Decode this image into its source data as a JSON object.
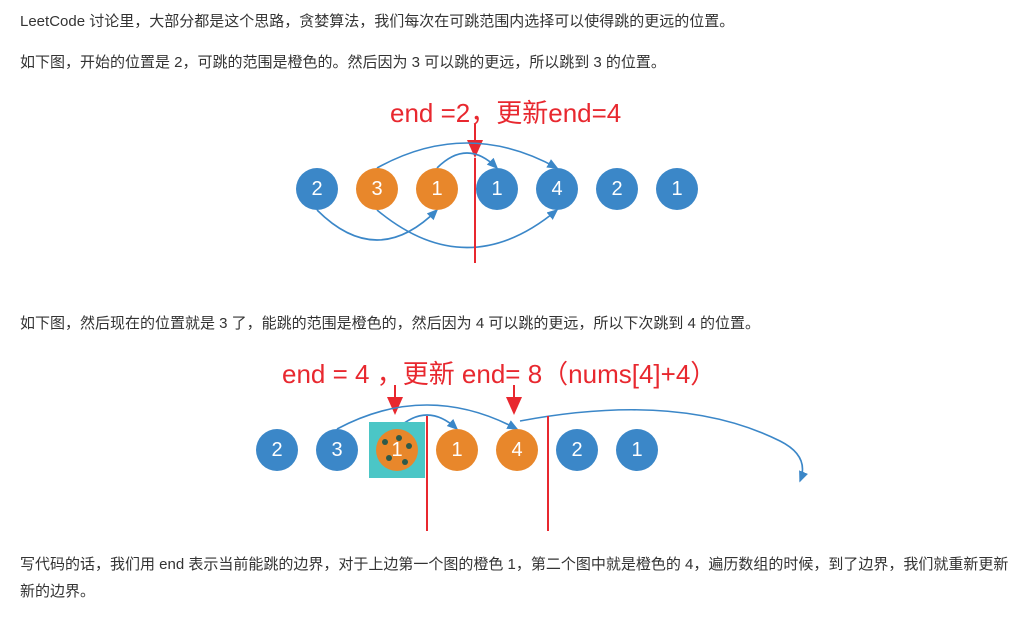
{
  "para1": "LeetCode 讨论里，大部分都是这个思路，贪婪算法，我们每次在可跳范围内选择可以使得跳的更远的位置。",
  "para2": "如下图，开始的位置是 2，可跳的范围是橙色的。然后因为 3 可以跳的更远，所以跳到 3 的位置。",
  "diagram1": {
    "annotation": "end =2，更新end=4",
    "circles": [
      {
        "val": "2",
        "color": "blue"
      },
      {
        "val": "3",
        "color": "orange"
      },
      {
        "val": "1",
        "color": "orange"
      },
      {
        "val": "1",
        "color": "blue"
      },
      {
        "val": "4",
        "color": "blue"
      },
      {
        "val": "2",
        "color": "blue"
      },
      {
        "val": "1",
        "color": "blue"
      }
    ]
  },
  "para3": "如下图，然后现在的位置就是 3 了，能跳的范围是橙色的，然后因为 4 可以跳的更远，所以下次跳到 4 的位置。",
  "diagram2": {
    "annotation": "end = 4 ，更新 end= 8（nums[4]+4）",
    "circles": [
      {
        "val": "2",
        "color": "blue"
      },
      {
        "val": "3",
        "color": "blue"
      },
      {
        "val": "1",
        "color": "teal"
      },
      {
        "val": "1",
        "color": "orange"
      },
      {
        "val": "4",
        "color": "orange"
      },
      {
        "val": "2",
        "color": "blue"
      },
      {
        "val": "1",
        "color": "blue"
      }
    ]
  },
  "para4": "写代码的话，我们用 end 表示当前能跳的边界，对于上边第一个图的橙色 1，第二个图中就是橙色的 4，遍历数组的时候，到了边界，我们就重新更新新的边界。"
}
